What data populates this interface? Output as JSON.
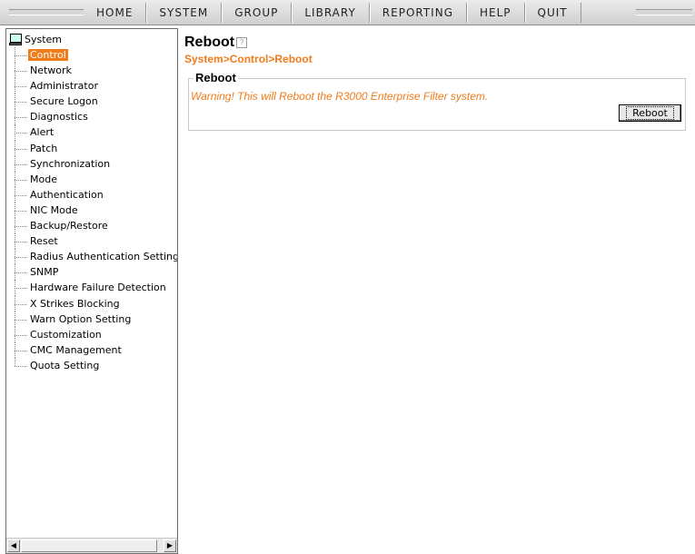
{
  "nav": {
    "items": [
      "HOME",
      "SYSTEM",
      "GROUP",
      "LIBRARY",
      "REPORTING",
      "HELP",
      "QUIT"
    ]
  },
  "sidebar": {
    "root_label": "System",
    "root_icon": "computer-icon",
    "items": [
      "Control",
      "Network",
      "Administrator",
      "Secure Logon",
      "Diagnostics",
      "Alert",
      "Patch",
      "Synchronization",
      "Mode",
      "Authentication",
      "NIC Mode",
      "Backup/Restore",
      "Reset",
      "Radius Authentication Setting",
      "SNMP",
      "Hardware Failure Detection",
      "X Strikes Blocking",
      "Warn Option Setting",
      "Customization",
      "CMC Management",
      "Quota Setting"
    ],
    "selected": "Control",
    "scroll_left": "◀",
    "scroll_right": "▶"
  },
  "main": {
    "title": "Reboot",
    "help_icon": "?",
    "breadcrumb": "System>Control>Reboot",
    "section_title": "Reboot",
    "warning": "Warning! This will Reboot the R3000 Enterprise Filter system.",
    "reboot_button": "Reboot"
  },
  "colors": {
    "accent": "#f07c1a"
  }
}
